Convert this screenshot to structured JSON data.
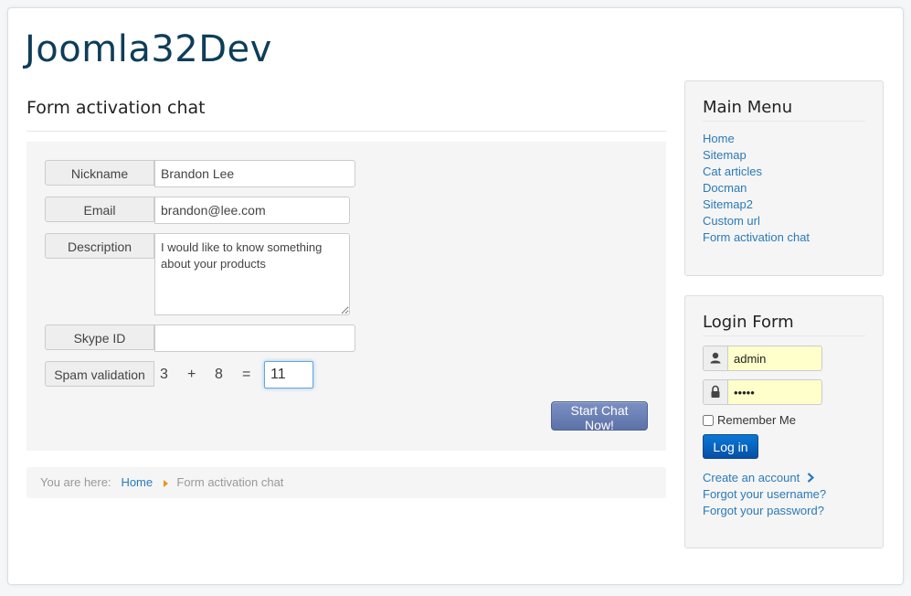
{
  "site": {
    "title": "Joomla32Dev"
  },
  "page": {
    "heading": "Form activation chat"
  },
  "form": {
    "nickname": {
      "label": "Nickname",
      "value": "Brandon Lee"
    },
    "email": {
      "label": "Email",
      "value": "brandon@lee.com"
    },
    "description": {
      "label": "Description",
      "value": "I would like to know something about your products"
    },
    "skype": {
      "label": "Skype ID",
      "value": ""
    },
    "spam": {
      "label": "Spam validation",
      "a": "3",
      "op": "+",
      "b": "8",
      "eq": "=",
      "answer": "11"
    },
    "submit_label": "Start Chat Now!"
  },
  "breadcrumb": {
    "prefix": "You are here:",
    "home": "Home",
    "current": "Form activation chat"
  },
  "main_menu": {
    "title": "Main Menu",
    "items": [
      "Home",
      "Sitemap",
      "Cat articles",
      "Docman",
      "Sitemap2",
      "Custom url",
      "Form activation chat"
    ]
  },
  "login": {
    "title": "Login Form",
    "username": "admin",
    "password": "admin",
    "remember_label": "Remember Me",
    "button_label": "Log in",
    "links": {
      "create": "Create an account",
      "forgot_user": "Forgot your username?",
      "forgot_pass": "Forgot your password?"
    }
  },
  "colors": {
    "title": "#0e3d59",
    "link": "#2a7ab8",
    "panel": "#f5f5f5",
    "login_field_bg": "#ffffcc",
    "primary_button": "#0b78d6"
  }
}
